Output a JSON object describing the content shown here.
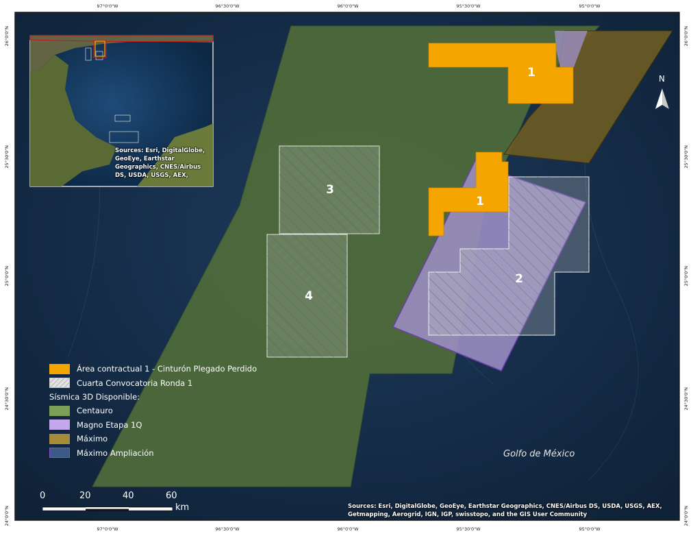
{
  "ticks": {
    "top": [
      "97°0'0\"W",
      "96°30'0\"W",
      "96°0'0\"W",
      "95°30'0\"W",
      "95°0'0\"W"
    ],
    "bottom": [
      "97°0'0\"W",
      "96°30'0\"W",
      "96°0'0\"W",
      "95°30'0\"W",
      "95°0'0\"W"
    ],
    "left": [
      "26°0'0\"N",
      "25°30'0\"N",
      "25°0'0\"N",
      "24°30'0\"N",
      "24°0'0\"N"
    ],
    "right": [
      "26°0'0\"N",
      "25°30'0\"N",
      "25°0'0\"N",
      "24°30'0\"N",
      "24°0'0\"N"
    ]
  },
  "blocks": {
    "area1_north": "1",
    "area1_south": "1",
    "block2": "2",
    "block3": "3",
    "block4": "4"
  },
  "legend": {
    "area_contractual": "Área contractual 1 - Cinturón Plegado Perdido",
    "cuarta_convocatoria": "Cuarta Convocatoria Ronda 1",
    "sismica_heading": "Sísmica 3D Disponible:",
    "centauro": "Centauro",
    "magno": "Magno Etapa 1Q",
    "maximo": "Máximo",
    "maximo_ampliacion": "Máximo Ampliación"
  },
  "sea_label": "Golfo de México",
  "north_arrow": "N",
  "scale": {
    "labels": [
      "0",
      "20",
      "40",
      "60"
    ],
    "unit": "km"
  },
  "credits": {
    "main_line1": "Sources: Esri, DigitalGlobe, GeoEye, Earthstar Geographics, CNES/Airbus DS, USDA, USGS, AEX,",
    "main_line2": "Getmapping, Aerogrid, IGN, IGP, swisstopo, and the GIS User Community",
    "inset": "Sources: Esri, DigitalGlobe, GeoEye, Earthstar Geographics, CNES/Airbus DS, USDA, USGS, AEX,"
  },
  "colors": {
    "sea": "#152d4a",
    "centauro": "#4f6b3a",
    "magno": "#9c8fc4",
    "maximo": "#6a5a24",
    "area": "#f5a500",
    "frame": "#1a1a1a",
    "magno_stroke": "#6a3fb0"
  },
  "icons": {
    "north": "north-arrow-icon",
    "hatch": "hatch-pattern"
  }
}
